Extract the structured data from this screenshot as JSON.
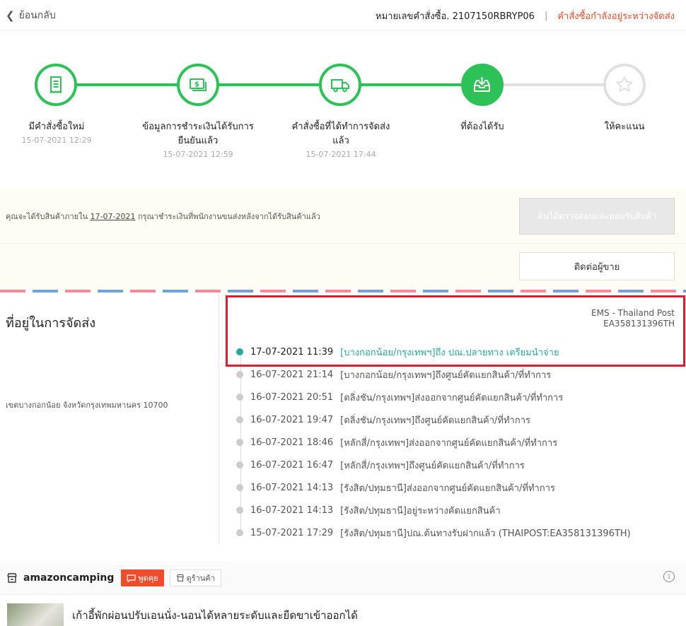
{
  "topbar": {
    "back_label": "ย้อนกลับ",
    "order_number": "หมายเลขคำสั่งซื้อ. 2107150RBRYP06",
    "separator": "|",
    "order_status": "คำสั่งซื้อกำลังอยู่ระหว่างจัดส่ง"
  },
  "steps": [
    {
      "label": "มีคำสั่งซื้อใหม่",
      "time": "15-07-2021 12:29",
      "state": "done",
      "icon": "receipt-icon"
    },
    {
      "label": "ข้อมูลการชำระเงินได้รับการยืนยันแล้ว",
      "time": "15-07-2021 12:59",
      "state": "done",
      "icon": "money-icon"
    },
    {
      "label": "คำสั่งซื้อที่ได้ทำการจัดส่งแล้ว",
      "time": "15-07-2021 17:44",
      "state": "done",
      "icon": "truck-icon"
    },
    {
      "label": "ที่ต้องได้รับ",
      "time": "",
      "state": "current",
      "icon": "inbox-download-icon"
    },
    {
      "label": "ให้คะแนน",
      "time": "",
      "state": "pending",
      "icon": "star-icon"
    }
  ],
  "notice": {
    "text_before": "คุณจะได้รับสินค้าภายใน ",
    "date": "17-07-2021",
    "text_after": " กรุณาชำระเงินที่พนักงานขนส่งหลังจากได้รับสินค้าแล้ว",
    "confirm_label": "ฉันได้ตรวจสอบและยอมรับสินค้า",
    "contact_label": "ติดต่อผู้ขาย"
  },
  "address": {
    "title": "ที่อยู่ในการจัดส่ง",
    "line": "เขตบางกอกน้อย จังหวัดกรุงเทพมหานคร 10700"
  },
  "tracking": {
    "carrier": "EMS - Thailand Post",
    "tracking_number": "EA358131396TH",
    "events": [
      {
        "time": "17-07-2021 11:39",
        "desc": "[บางกอกน้อย/กรุงเทพฯ]ถึง ปณ.ปลายทาง เตรียมนำจ่าย"
      },
      {
        "time": "16-07-2021 21:14",
        "desc": "[บางกอกน้อย/กรุงเทพฯ]ถึงศูนย์คัดแยกสินค้า/ที่ทำการ"
      },
      {
        "time": "16-07-2021 20:51",
        "desc": "[ตลิ่งชัน/กรุงเทพฯ]ส่งออกจากศูนย์คัดแยกสินค้า/ที่ทำการ"
      },
      {
        "time": "16-07-2021 19:47",
        "desc": "[ตลิ่งชัน/กรุงเทพฯ]ถึงศูนย์คัดแยกสินค้า/ที่ทำการ"
      },
      {
        "time": "16-07-2021 18:46",
        "desc": "[หลักสี่/กรุงเทพฯ]ส่งออกจากศูนย์คัดแยกสินค้า/ที่ทำการ"
      },
      {
        "time": "16-07-2021 16:47",
        "desc": "[หลักสี่/กรุงเทพฯ]ถึงศูนย์คัดแยกสินค้า/ที่ทำการ"
      },
      {
        "time": "16-07-2021 14:13",
        "desc": "[รังสิต/ปทุมธานี]ส่งออกจากศูนย์คัดแยกสินค้า/ที่ทำการ"
      },
      {
        "time": "16-07-2021 14:13",
        "desc": "[รังสิต/ปทุมธานี]อยู่ระหว่างคัดแยกสินค้า"
      },
      {
        "time": "15-07-2021 17:29",
        "desc": "[รังสิต/ปทุมธานี]ปณ.ต้นทางรับฝากแล้ว (THAIPOST:EA358131396TH)"
      }
    ]
  },
  "shop": {
    "name": "amazoncamping",
    "chat_label": "พูดคุย",
    "store_label": "ดูร้านค้า",
    "info_glyph": "i"
  },
  "product": {
    "name": "เก้าอี้พักผ่อนปรับเอนนั่ง-นอนได้หลายระดับและยืดขาเข้าออกได้"
  },
  "colors": {
    "brand": "#ee4d2d",
    "step_done": "#2dc258",
    "tracking_current": "#26aa99",
    "highlight": "#e21b2d"
  }
}
